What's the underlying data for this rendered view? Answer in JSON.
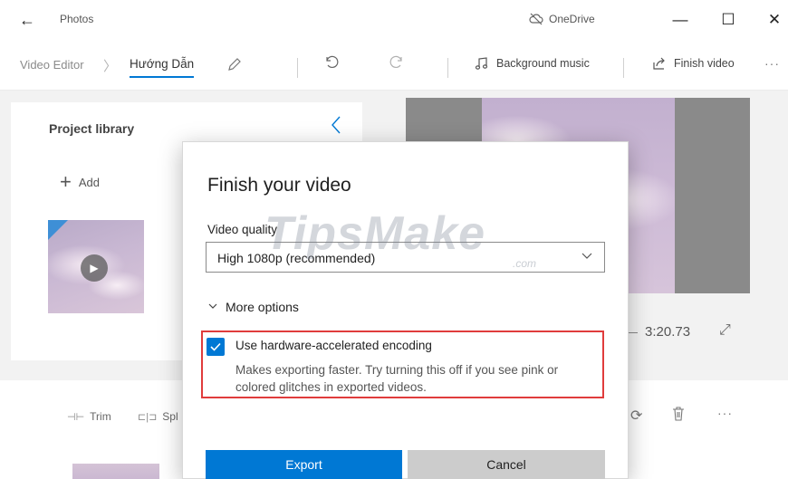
{
  "titlebar": {
    "title": "Photos",
    "onedrive_label": "OneDrive",
    "minimize_glyph": "—",
    "maximize_glyph": "☐",
    "close_glyph": "✕",
    "back_glyph": "←"
  },
  "toolbar": {
    "breadcrumb_root": "Video Editor",
    "breadcrumb_separator": "〉",
    "project_name": "Hướng Dẫn",
    "background_music_label": "Background music",
    "finish_video_label": "Finish video",
    "more_glyph": "···"
  },
  "library": {
    "title": "Project library",
    "add_label": "Add"
  },
  "preview": {
    "end_time": "3:20.73"
  },
  "storyboard": {
    "trim_label": "Trim",
    "split_label": "Spl"
  },
  "dialog": {
    "title": "Finish your video",
    "quality_label": "Video quality",
    "quality_value": "High 1080p (recommended)",
    "more_options_label": "More options",
    "hw_encoding_label": "Use hardware-accelerated encoding",
    "hw_encoding_checked": true,
    "hw_encoding_description": "Makes exporting faster. Try turning this off if you see pink or colored glitches in exported videos.",
    "export_label": "Export",
    "cancel_label": "Cancel",
    "highlight_color": "#e03c3c",
    "accent_color": "#0078d4"
  },
  "watermark": {
    "text": "TipsMake",
    "suffix": ".com"
  }
}
